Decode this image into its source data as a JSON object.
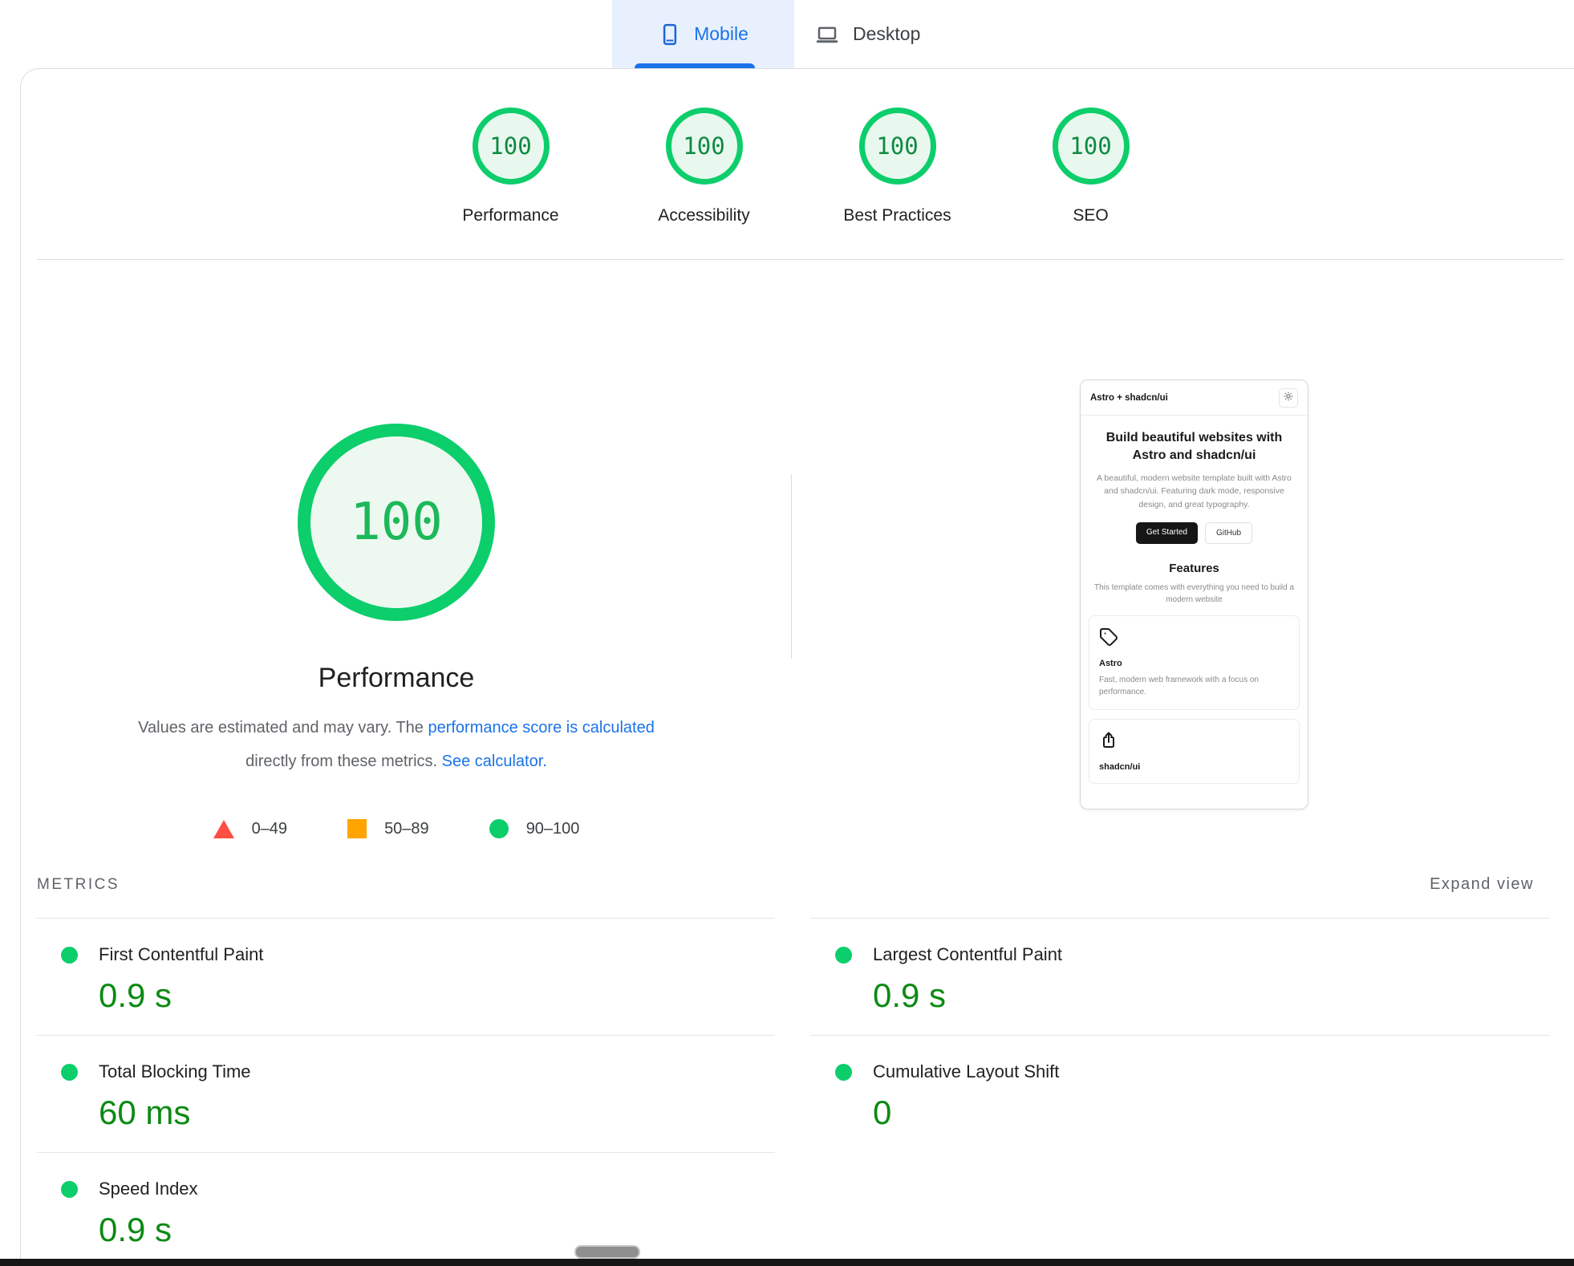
{
  "tabs": {
    "mobile_label": "Mobile",
    "desktop_label": "Desktop"
  },
  "summary": {
    "categories": [
      {
        "score": "100",
        "label": "Performance"
      },
      {
        "score": "100",
        "label": "Accessibility"
      },
      {
        "score": "100",
        "label": "Best Practices"
      },
      {
        "score": "100",
        "label": "SEO"
      }
    ]
  },
  "gauge": {
    "score": "100",
    "title": "Performance",
    "description": {
      "text_1": "Values are estimated and may vary. The ",
      "link_1": "performance score is calculated",
      "text_2": " directly from these metrics. ",
      "link_2": "See calculator."
    },
    "legend": [
      {
        "range": "0–49",
        "shape": "triangle",
        "color": "#ff4e42"
      },
      {
        "range": "50–89",
        "shape": "square",
        "color": "#ffa400"
      },
      {
        "range": "90–100",
        "shape": "circle",
        "color": "#0cce6b"
      }
    ]
  },
  "metrics": {
    "heading": "METRICS",
    "expand_label": "Expand view",
    "left": [
      {
        "label": "First Contentful Paint",
        "value": "0.9 s"
      },
      {
        "label": "Total Blocking Time",
        "value": "60 ms"
      },
      {
        "label": "Speed Index",
        "value": "0.9 s"
      }
    ],
    "right": [
      {
        "label": "Largest Contentful Paint",
        "value": "0.9 s"
      },
      {
        "label": "Cumulative Layout Shift",
        "value": "0"
      }
    ]
  },
  "preview": {
    "site_title": "Astro + shadcn/ui",
    "hero_title": "Build beautiful websites with Astro and shadcn/ui",
    "hero_description": "A beautiful, modern website template built with Astro and shadcn/ui. Featuring dark mode, responsive design, and great typography.",
    "primary_button": "Get Started",
    "secondary_button": "GitHub",
    "features_title": "Features",
    "features_description": "This template comes with everything you need to build a modern website",
    "feature_cards": [
      {
        "title": "Astro",
        "description": "Fast, modern web framework with a focus on performance."
      },
      {
        "title": "shadcn/ui"
      }
    ]
  },
  "colors": {
    "accent_blue": "#1a73e8",
    "pass_green": "#0cce6b",
    "metric_value_green": "#0c8a13",
    "average_orange": "#ffa400",
    "fail_red": "#ff4e42",
    "tab_selected_bg": "#e8f0fe"
  },
  "icons": {
    "mobile_tab": "smartphone-icon",
    "desktop_tab": "laptop-icon",
    "preview_theme_toggle": "sun-icon",
    "astro_card": "tag-icon",
    "shadcn_card": "share-icon",
    "metric_status": "green-dot-icon"
  }
}
